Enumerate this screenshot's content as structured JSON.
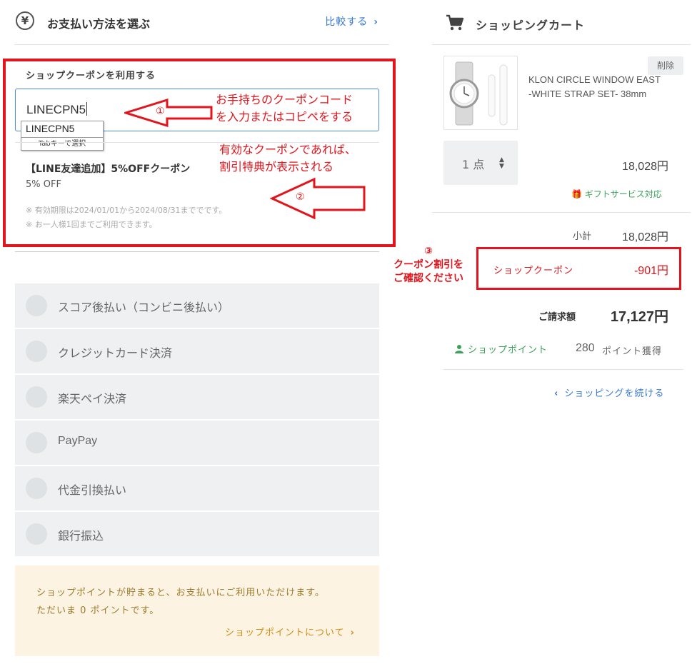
{
  "payment": {
    "title": "お支払い方法を選ぶ",
    "compare_link": "比較する",
    "coupon": {
      "section_label": "ショップクーポンを利用する",
      "input_value": "LINECPN5",
      "autocomplete_item": "LINECPN5",
      "autocomplete_hint": "Tabキーで選択",
      "name": "【LINE友達追加】5%OFFクーポン",
      "discount": "5% OFF",
      "note_validity": "※ 有効期限は2024/01/01から2024/08/31まででです。",
      "note_limit": "※ お一人様1回までご利用できます。"
    },
    "methods": [
      {
        "label": "スコア後払い（コンビニ後払い）"
      },
      {
        "label": "クレジットカード決済"
      },
      {
        "label": "楽天ペイ決済"
      },
      {
        "label": "PayPay"
      },
      {
        "label": "代金引換払い"
      },
      {
        "label": "銀行振込"
      }
    ],
    "point_notice": {
      "line1": "ショップポイントが貯まると、お支払いにご利用いただけます。",
      "line2": "ただいま 0 ポイントです。",
      "link": "ショップポイントについて"
    }
  },
  "cart": {
    "title": "ショッピングカート",
    "delete_label": "削除",
    "product_name": "KLON CIRCLE WINDOW EAST -WHITE STRAP SET- 38mm",
    "quantity": "1 点",
    "item_price": "18,028円",
    "gift_service": "ギフトサービス対応",
    "subtotal_label": "小計",
    "subtotal": "18,028円",
    "coupon_label": "ショップクーポン",
    "coupon_amount": "-901円",
    "billing_label": "ご請求額",
    "billing_amount": "17,127円",
    "shop_point_label": "ショップポイント",
    "shop_point_value": "280",
    "shop_point_unit": "ポイント獲得",
    "continue_link": "ショッピングを続ける"
  },
  "annotations": {
    "a1_mark": "①",
    "a1_line1": "お手持ちのクーポンコード",
    "a1_line2": "を入力またはコピペをする",
    "a2_mark": "②",
    "a2_line1": "有効なクーポンであれば、",
    "a2_line2": "割引特典が表示される",
    "a3_mark": "③",
    "a3_line1": "クーポン割引を",
    "a3_line2": "ご確認ください"
  },
  "colors": {
    "accent_link": "#3a7ad6",
    "annotation_red": "#e3141b",
    "point_green": "#3aa35a",
    "notice_bg": "#fdf3e2"
  }
}
